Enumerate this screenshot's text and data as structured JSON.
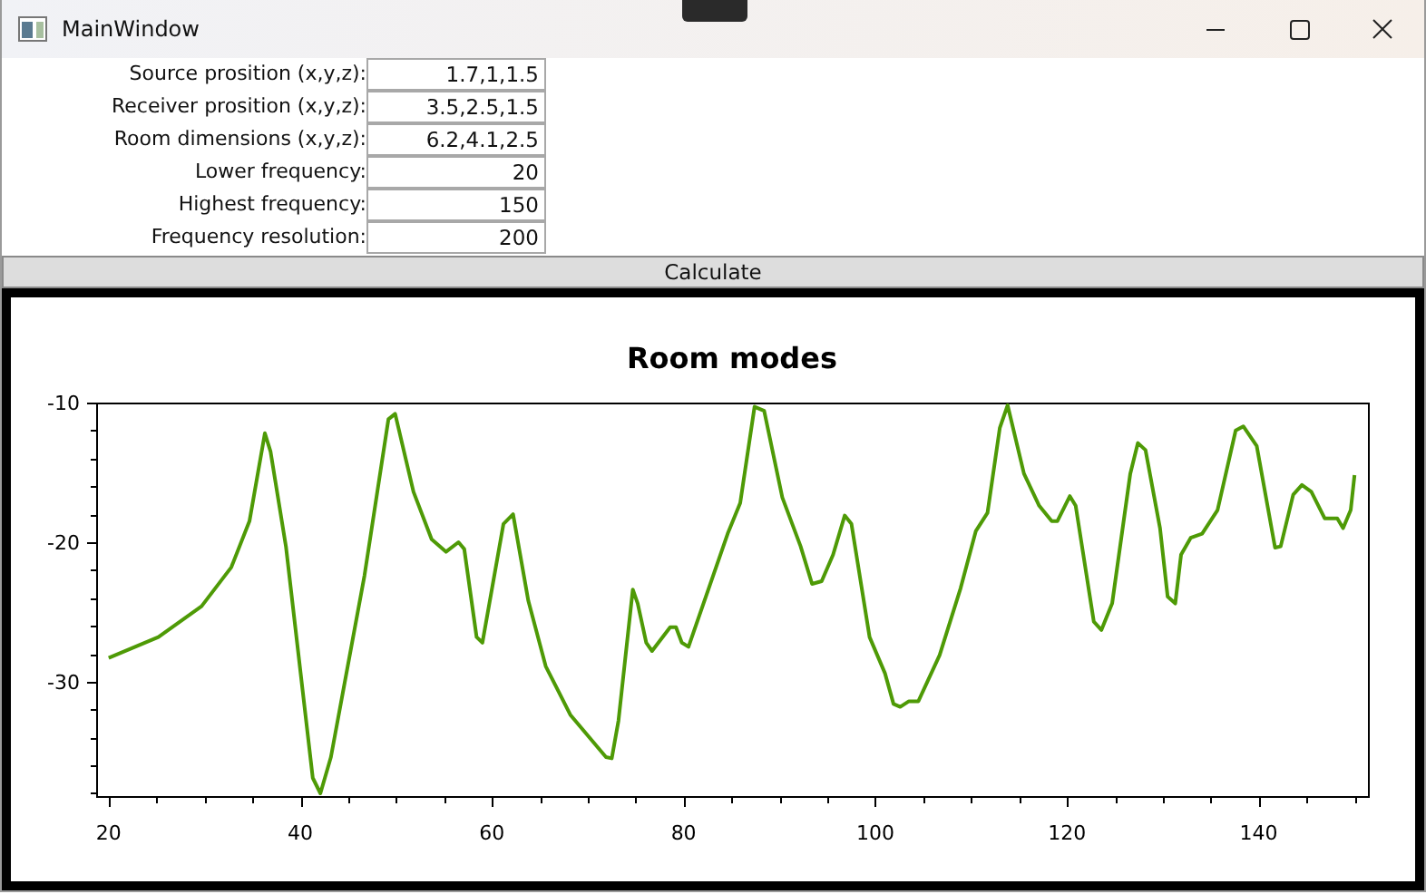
{
  "window": {
    "title": "MainWindow"
  },
  "fields": [
    {
      "label": "Source prosition (x,y,z):",
      "value": "1.7,1,1.5"
    },
    {
      "label": "Receiver prosition (x,y,z):",
      "value": "3.5,2.5,1.5"
    },
    {
      "label": "Room dimensions (x,y,z):",
      "value": "6.2,4.1,2.5"
    },
    {
      "label": "Lower frequency:",
      "value": "20"
    },
    {
      "label": "Highest frequency:",
      "value": "150"
    },
    {
      "label": "Frequency resolution:",
      "value": "200"
    }
  ],
  "calculate_button": "Calculate",
  "chart": {
    "chart_data": {
      "type": "line",
      "title": "Room modes",
      "xlim": [
        18.7,
        151.4
      ],
      "ylim": [
        -38.2,
        -10
      ],
      "xticks": [
        20,
        40,
        60,
        80,
        100,
        120,
        140
      ],
      "yticks": [
        -10,
        -20,
        -30
      ],
      "x": [
        20,
        25.2,
        29.7,
        32.8,
        34.7,
        36.3,
        36.9,
        38.5,
        41.3,
        42.1,
        43.2,
        46.7,
        49.2,
        49.9,
        51.8,
        53.7,
        55.2,
        56.5,
        57.1,
        58.4,
        59.0,
        61.2,
        62.2,
        63.8,
        65.6,
        68.2,
        71.9,
        72.5,
        73.2,
        74.7,
        75.2,
        76.1,
        76.7,
        78.6,
        79.2,
        79.8,
        80.5,
        84.6,
        85.9,
        87.4,
        88.4,
        90.3,
        92.2,
        93.4,
        94.4,
        95.6,
        96.8,
        97.5,
        99.4,
        101.0,
        101.9,
        102.6,
        103.5,
        104.5,
        106.7,
        108.9,
        110.5,
        111.7,
        113.0,
        113.8,
        115.5,
        117.1,
        118.4,
        119.0,
        120.3,
        120.9,
        122.8,
        123.6,
        124.7,
        126.6,
        127.4,
        128.2,
        129.7,
        130.5,
        131.3,
        131.9,
        132.9,
        134.1,
        135.7,
        137.6,
        138.4,
        139.8,
        141.7,
        142.3,
        143.6,
        144.5,
        145.5,
        146.9,
        148.2,
        148.8,
        149.6,
        150.0
      ],
      "series": [
        {
          "color": "#4e9a06",
          "values": [
            -28.3,
            -26.8,
            -24.6,
            -21.8,
            -18.5,
            -12.2,
            -13.5,
            -20.3,
            -36.9,
            -38.0,
            -35.4,
            -22.4,
            -11.2,
            -10.8,
            -16.4,
            -19.8,
            -20.7,
            -20.0,
            -20.5,
            -26.8,
            -27.2,
            -18.7,
            -18.0,
            -24.2,
            -28.9,
            -32.4,
            -35.4,
            -35.5,
            -32.8,
            -23.4,
            -24.4,
            -27.2,
            -27.8,
            -26.1,
            -26.1,
            -27.2,
            -27.5,
            -19.4,
            -17.2,
            -10.3,
            -10.6,
            -16.8,
            -20.3,
            -23.0,
            -22.8,
            -20.9,
            -18.1,
            -18.7,
            -26.8,
            -29.4,
            -31.6,
            -31.8,
            -31.4,
            -31.4,
            -28.1,
            -23.3,
            -19.2,
            -17.9,
            -11.8,
            -10.2,
            -15.1,
            -17.4,
            -18.5,
            -18.5,
            -16.7,
            -17.4,
            -25.7,
            -26.3,
            -24.4,
            -15.1,
            -12.9,
            -13.4,
            -19.0,
            -23.9,
            -24.4,
            -20.9,
            -19.7,
            -19.4,
            -17.7,
            -12.0,
            -11.7,
            -13.1,
            -20.4,
            -20.3,
            -16.6,
            -15.9,
            -16.4,
            -18.3,
            -18.3,
            -19.0,
            -17.7,
            -15.2
          ]
        }
      ]
    }
  }
}
